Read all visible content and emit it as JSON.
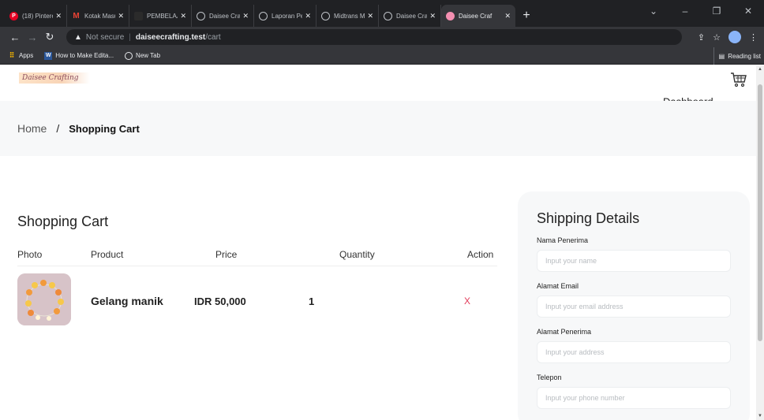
{
  "browser": {
    "tabs": [
      {
        "title": "(18) Pintere",
        "icon": "pinterest-icon",
        "color": "#e60023",
        "glyph": "P"
      },
      {
        "title": "Kotak Masu",
        "icon": "gmail-icon",
        "color": "#ea4335",
        "glyph": "M"
      },
      {
        "title": "PEMBELAJ",
        "icon": "site-icon",
        "color": "#2b2b2b",
        "glyph": ""
      },
      {
        "title": "Daisee Craf",
        "icon": "globe-icon",
        "color": "#5f6368",
        "glyph": ""
      },
      {
        "title": "Laporan Pe",
        "icon": "globe-icon",
        "color": "#5f6368",
        "glyph": ""
      },
      {
        "title": "Midtrans M",
        "icon": "globe-icon",
        "color": "#5f6368",
        "glyph": ""
      },
      {
        "title": "Daisee Craf",
        "icon": "globe-icon",
        "color": "#5f6368",
        "glyph": ""
      },
      {
        "title": "Daisee Craf",
        "icon": "pink-circle-icon",
        "color": "#f48fb1",
        "glyph": "",
        "active": true
      }
    ],
    "address": {
      "security": "Not secure",
      "host": "daiseecrafting.test",
      "path": "/cart"
    },
    "bookmarks": [
      {
        "label": "Apps",
        "icon": "apps-grid-icon",
        "color": "#f4b400"
      },
      {
        "label": "How to Make Edita...",
        "icon": "word-icon",
        "color": "#2b579a"
      },
      {
        "label": "New Tab",
        "icon": "globe-icon",
        "color": "#5f6368"
      }
    ],
    "reading_list": "Reading list"
  },
  "header": {
    "logo_text": "Daisee Crafting",
    "dashboard_label": "Dashboard"
  },
  "breadcrumb": {
    "home": "Home",
    "separator": "/",
    "current": "Shopping Cart"
  },
  "cart": {
    "title": "Shopping Cart",
    "columns": {
      "photo": "Photo",
      "product": "Product",
      "price": "Price",
      "quantity": "Quantity",
      "action": "Action"
    },
    "items": [
      {
        "product": "Gelang manik",
        "price": "IDR 50,000",
        "quantity": "1",
        "action": "X"
      }
    ]
  },
  "shipping": {
    "title": "Shipping Details",
    "fields": [
      {
        "label": "Nama Penerima",
        "placeholder": "Input your name"
      },
      {
        "label": "Alamat Email",
        "placeholder": "Input your email address"
      },
      {
        "label": "Alamat Penerima",
        "placeholder": "Input your address"
      },
      {
        "label": "Telepon",
        "placeholder": "Input your phone number"
      }
    ]
  },
  "colors": {
    "accent_remove": "#e23d5b",
    "chrome_dark": "#202124",
    "panel_bg": "#f7f8f9"
  }
}
